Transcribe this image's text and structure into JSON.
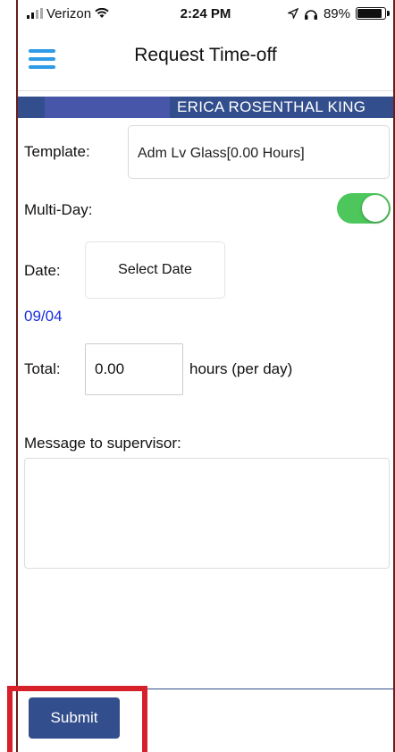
{
  "status_bar": {
    "carrier": "Verizon",
    "time": "2:24 PM",
    "battery": "89%",
    "battery_level": 0.89
  },
  "header": {
    "title": "Request Time-off"
  },
  "employee": {
    "name": "ERICA  ROSENTHAL KING"
  },
  "form": {
    "template_label": "Template:",
    "template_value": "Adm Lv Glass[0.00 Hours]",
    "multi_day_label": "Multi-Day:",
    "multi_day_on": true,
    "date_label": "Date:",
    "select_date_label": "Select Date",
    "date_value": "09/04",
    "total_label": "Total:",
    "total_value": "0.00",
    "hours_suffix": "hours (per day)",
    "message_label": "Message to supervisor:",
    "message_value": ""
  },
  "actions": {
    "submit_label": "Submit"
  },
  "colors": {
    "accent_blue": "#334e8c",
    "toggle_green": "#4dc65c",
    "menu_blue": "#2f9be6",
    "date_blue": "#1a2ee0",
    "highlight_red": "#d6202a"
  }
}
